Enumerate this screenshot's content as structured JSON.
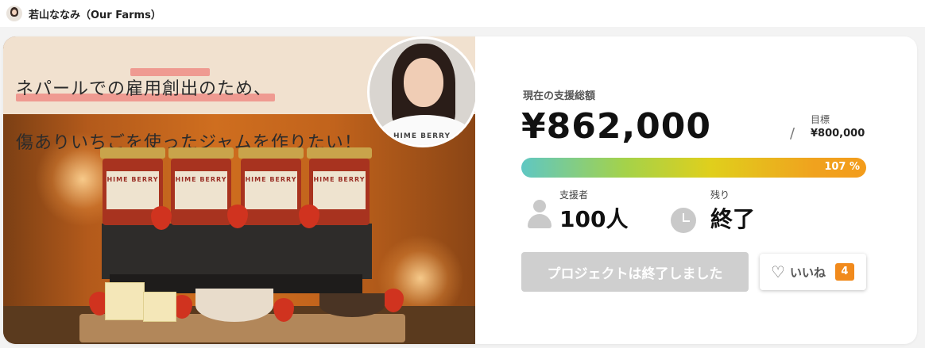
{
  "owner": {
    "name": "若山ななみ（Our Farms）"
  },
  "hero": {
    "headline_line1": "ネパールでの雇用創出のため、",
    "headline_line2": "傷ありいちごを使ったジャムを作りたい！",
    "shirt_logo": "HIME BERRY",
    "jar_brand": "HIME BERRY"
  },
  "funding": {
    "raised_label": "現在の支援総額",
    "raised_amount": "¥862,000",
    "separator": "/",
    "goal_label": "目標",
    "goal_amount": "¥800,000",
    "progress_percent": 107,
    "progress_text": "107 %"
  },
  "stats": {
    "supporters_label": "支援者",
    "supporters_value": "100人",
    "remaining_label": "残り",
    "remaining_value": "終了"
  },
  "actions": {
    "ended_label": "プロジェクトは終了しました",
    "like_label": "いいね",
    "like_count": "4"
  },
  "colors": {
    "progress_start": "#5fc7c3",
    "progress_end": "#f39c1b",
    "like_badge": "#f18a1c",
    "headline_marker": "#ef8d86"
  }
}
